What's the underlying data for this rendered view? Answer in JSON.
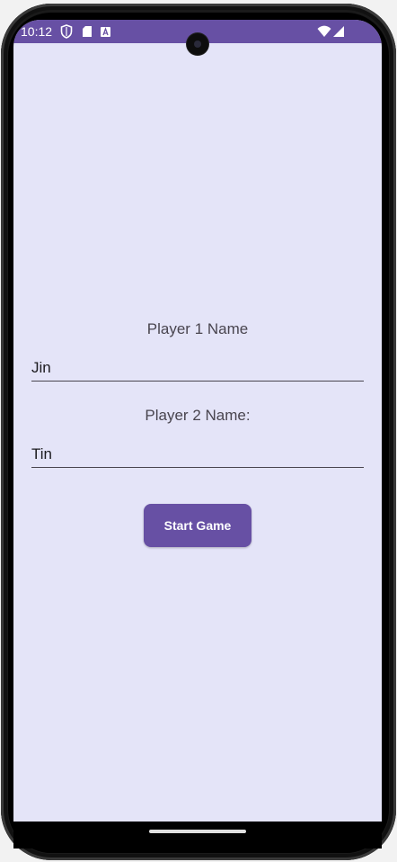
{
  "status_bar": {
    "time": "10:12",
    "icons": [
      "shield-icon",
      "sd-card-icon",
      "font-a-icon",
      "wifi-icon",
      "signal-icon"
    ],
    "color": "#6750a4"
  },
  "form": {
    "player1_label": "Player 1 Name",
    "player1_value": "Jin",
    "player2_label": "Player 2 Name:",
    "player2_value": "Tin",
    "start_button_label": "Start Game"
  },
  "colors": {
    "background": "#e4e4f8",
    "accent": "#6750a4",
    "text": "#49454f"
  }
}
